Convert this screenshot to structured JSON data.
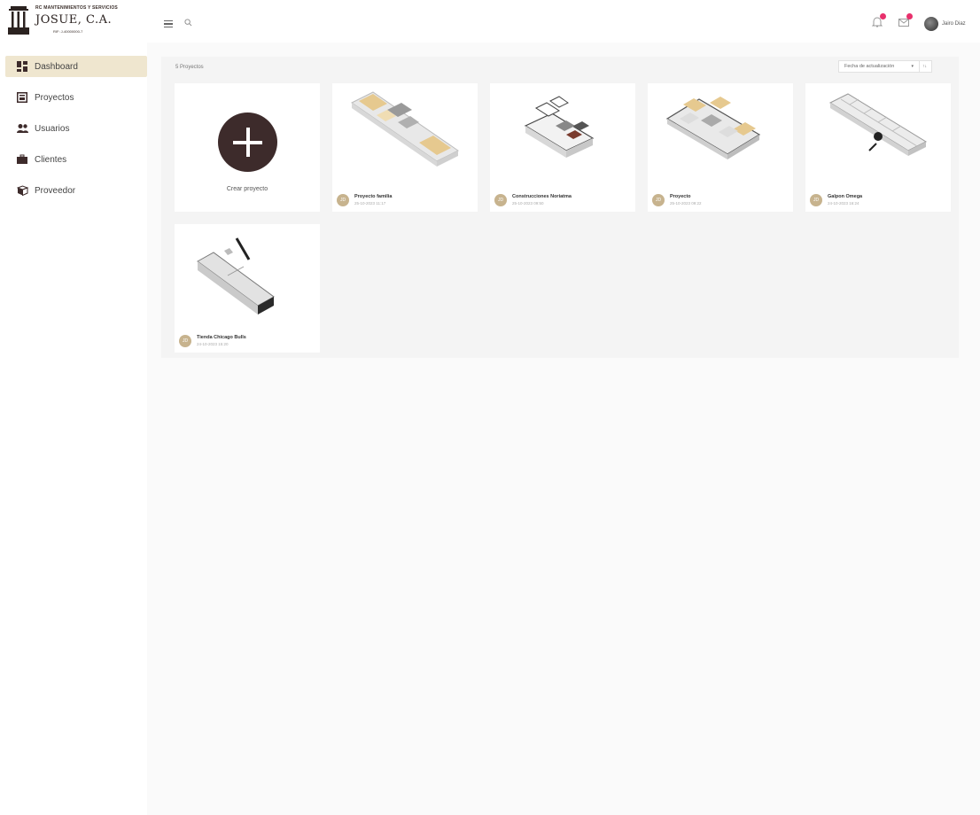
{
  "brand": {
    "top": "RC MANTENIMIENTOS Y SERVICIOS",
    "name": "JOSUE, C.A.",
    "rif": "RIF: J-40000000-7"
  },
  "sidebar": {
    "items": [
      {
        "label": "Dashboard",
        "icon": "dashboard-icon",
        "active": true
      },
      {
        "label": "Proyectos",
        "icon": "projects-icon"
      },
      {
        "label": "Usuarios",
        "icon": "users-icon"
      },
      {
        "label": "Clientes",
        "icon": "briefcase-icon"
      },
      {
        "label": "Proveedor",
        "icon": "gift-box-icon"
      }
    ]
  },
  "header": {
    "user_name": "Jairo Diaz",
    "notification_icons": [
      "bell-icon",
      "mail-icon"
    ],
    "accent": "#e8306c"
  },
  "projects": {
    "count_label": "5 Proyectos",
    "sort_label": "Fecha de actualización",
    "sort_dir": "↑↓",
    "create_label": "Crear proyecto",
    "items": [
      {
        "title": "Proyecto familia",
        "date": "25-10-2023 11:17",
        "initials": "JD"
      },
      {
        "title": "Construcciones Noriatma",
        "date": "25-10-2023 09:50",
        "initials": "JD"
      },
      {
        "title": "Proyecto",
        "date": "25-10-2023 09:22",
        "initials": "JD"
      },
      {
        "title": "Galpon Omega",
        "date": "24-10-2023 16:24",
        "initials": "JD"
      },
      {
        "title": "Tienda Chicago Bulls",
        "date": "24-10-2023 15:20",
        "initials": "JD"
      }
    ]
  },
  "colors": {
    "brand_dark": "#3d2b2b",
    "active_nav": "#efe6cf",
    "avatar_tan": "#c7b38e"
  }
}
